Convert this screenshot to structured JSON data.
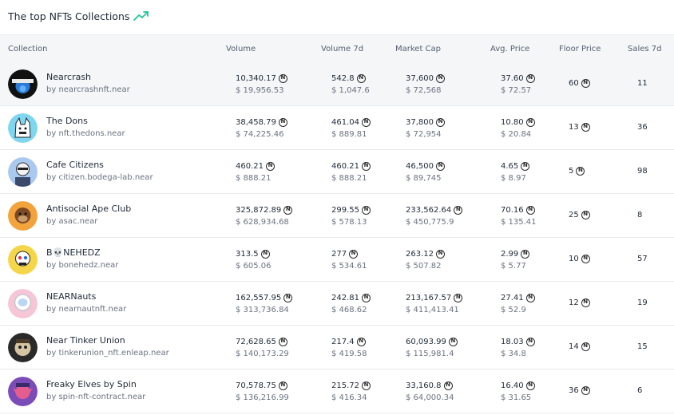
{
  "header": {
    "title": "The top NFTs Collections"
  },
  "columns": {
    "collection": "Collection",
    "volume": "Volume",
    "volume_7d": "Volume 7d",
    "market_cap": "Market Cap",
    "avg_price": "Avg. Price",
    "floor_price": "Floor Price",
    "sales_7d": "Sales 7d"
  },
  "colors": {
    "accent": "#22c39b",
    "header_bg": "#f4f6f8",
    "border": "#e6e9ee"
  },
  "rows": [
    {
      "name": "Nearcrash",
      "owner": "by nearcrashnft.near",
      "volume": "10,340.17",
      "volume_usd": "$ 19,956.53",
      "volume_7d": "542.8",
      "volume_7d_usd": "$ 1,047.6",
      "market_cap": "37,600",
      "market_cap_usd": "$ 72,568",
      "avg_price": "37.60",
      "avg_price_usd": "$ 72.57",
      "floor": "60",
      "sales": "11"
    },
    {
      "name": "The Dons",
      "owner": "by nft.thedons.near",
      "volume": "38,458.79",
      "volume_usd": "$ 74,225.46",
      "volume_7d": "461.04",
      "volume_7d_usd": "$ 889.81",
      "market_cap": "37,800",
      "market_cap_usd": "$ 72,954",
      "avg_price": "10.80",
      "avg_price_usd": "$ 20.84",
      "floor": "13",
      "sales": "36"
    },
    {
      "name": "Cafe Citizens",
      "owner": "by citizen.bodega-lab.near",
      "volume": "460.21",
      "volume_usd": "$ 888.21",
      "volume_7d": "460.21",
      "volume_7d_usd": "$ 888.21",
      "market_cap": "46,500",
      "market_cap_usd": "$ 89,745",
      "avg_price": "4.65",
      "avg_price_usd": "$ 8.97",
      "floor": "5",
      "sales": "98"
    },
    {
      "name": "Antisocial Ape Club",
      "owner": "by asac.near",
      "volume": "325,872.89",
      "volume_usd": "$ 628,934.68",
      "volume_7d": "299.55",
      "volume_7d_usd": "$ 578.13",
      "market_cap": "233,562.64",
      "market_cap_usd": "$ 450,775.9",
      "avg_price": "70.16",
      "avg_price_usd": "$ 135.41",
      "floor": "25",
      "sales": "8"
    },
    {
      "name": "B💀NEHEDZ",
      "owner": "by bonehedz.near",
      "volume": "313.5",
      "volume_usd": "$ 605.06",
      "volume_7d": "277",
      "volume_7d_usd": "$ 534.61",
      "market_cap": "263.12",
      "market_cap_usd": "$ 507.82",
      "avg_price": "2.99",
      "avg_price_usd": "$ 5.77",
      "floor": "10",
      "sales": "57"
    },
    {
      "name": "NEARNauts",
      "owner": "by nearnautnft.near",
      "volume": "162,557.95",
      "volume_usd": "$ 313,736.84",
      "volume_7d": "242.81",
      "volume_7d_usd": "$ 468.62",
      "market_cap": "213,167.57",
      "market_cap_usd": "$ 411,413.41",
      "avg_price": "27.41",
      "avg_price_usd": "$ 52.9",
      "floor": "12",
      "sales": "19"
    },
    {
      "name": "Near Tinker Union",
      "owner": "by tinkerunion_nft.enleap.near",
      "volume": "72,628.65",
      "volume_usd": "$ 140,173.29",
      "volume_7d": "217.4",
      "volume_7d_usd": "$ 419.58",
      "market_cap": "60,093.99",
      "market_cap_usd": "$ 115,981.4",
      "avg_price": "18.03",
      "avg_price_usd": "$ 34.8",
      "floor": "14",
      "sales": "15"
    },
    {
      "name": "Freaky Elves by Spin",
      "owner": "by spin-nft-contract.near",
      "volume": "70,578.75",
      "volume_usd": "$ 136,216.99",
      "volume_7d": "215.72",
      "volume_7d_usd": "$ 416.34",
      "market_cap": "33,160.8",
      "market_cap_usd": "$ 64,000.34",
      "avg_price": "16.40",
      "avg_price_usd": "$ 31.65",
      "floor": "36",
      "sales": "6"
    }
  ]
}
